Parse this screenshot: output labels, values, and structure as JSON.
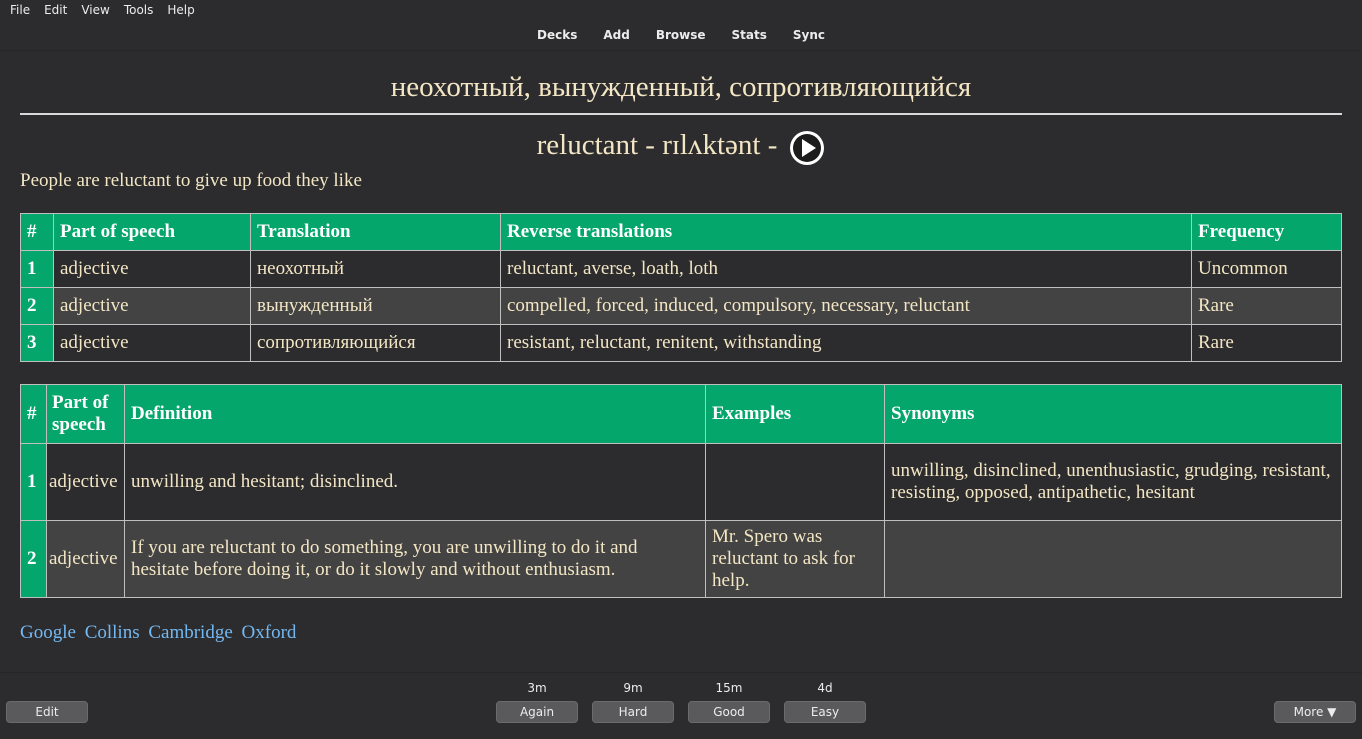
{
  "menu": [
    "File",
    "Edit",
    "View",
    "Tools",
    "Help"
  ],
  "toolbar": [
    "Decks",
    "Add",
    "Browse",
    "Stats",
    "Sync"
  ],
  "card": {
    "front": "неохотный, вынужденный, сопротивляющийся",
    "word": "reluctant - rɪlʌktənt -",
    "sentence": "People are reluctant to give up food they like",
    "translations": {
      "headers": [
        "#",
        "Part of speech",
        "Translation",
        "Reverse translations",
        "Frequency"
      ],
      "rows": [
        [
          "1",
          "adjective",
          "неохотный",
          "reluctant, averse, loath, loth",
          "Uncommon"
        ],
        [
          "2",
          "adjective",
          "вынужденный",
          "compelled, forced, induced, compulsory, necessary, reluctant",
          "Rare"
        ],
        [
          "3",
          "adjective",
          "сопротивляющийся",
          "resistant, reluctant, renitent, withstanding",
          "Rare"
        ]
      ]
    },
    "definitions": {
      "headers": [
        "#",
        "Part of speech",
        "Definition",
        "Examples",
        "Synonyms"
      ],
      "rows": [
        [
          "1",
          "adjective",
          "unwilling and hesitant; disinclined.",
          "",
          "unwilling, disinclined, unenthusiastic, grudging, resistant, resisting, opposed, antipathetic, hesitant"
        ],
        [
          "2",
          "adjective",
          "If you are reluctant to do something, you are unwilling to do it and hesitate before doing it, or do it slowly and without enthusiasm.",
          "Mr. Spero was reluctant to ask for help.",
          ""
        ]
      ]
    },
    "links": [
      "Google",
      "Collins",
      "Cambridge",
      "Oxford"
    ]
  },
  "bottom": {
    "edit_label": "Edit",
    "more_label": "More ▼",
    "answers": [
      {
        "time": "3m",
        "label": "Again"
      },
      {
        "time": "9m",
        "label": "Hard"
      },
      {
        "time": "15m",
        "label": "Good"
      },
      {
        "time": "4d",
        "label": "Easy"
      }
    ]
  },
  "colors": {
    "background": "#2c2c2e",
    "header_green": "#05a66c",
    "text": "#f3e6c4",
    "link": "#74b8f1"
  }
}
